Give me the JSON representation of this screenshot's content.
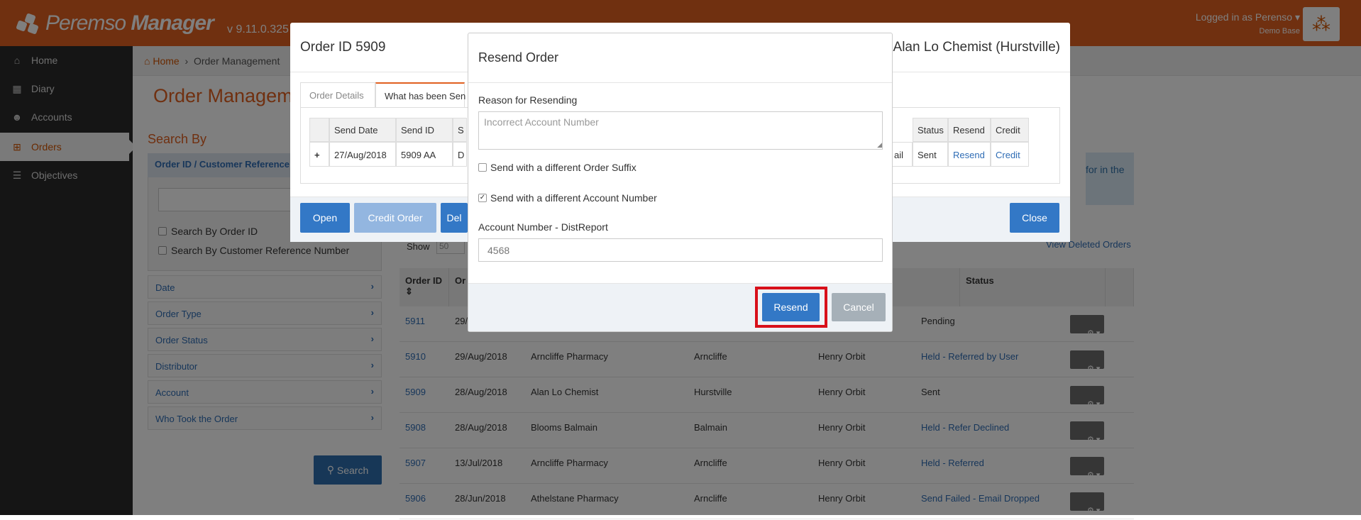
{
  "header": {
    "app_name_light": "Peremso",
    "app_name_bold": "Manager",
    "version": "v 9.11.0.325",
    "logged_in": "Logged in as Perenso",
    "base": "Demo Base"
  },
  "sidebar": {
    "items": [
      {
        "label": "Home",
        "icon": "home-icon"
      },
      {
        "label": "Diary",
        "icon": "calendar-icon"
      },
      {
        "label": "Accounts",
        "icon": "users-icon"
      },
      {
        "label": "Orders",
        "icon": "cart-icon"
      },
      {
        "label": "Objectives",
        "icon": "list-icon"
      }
    ],
    "active": "Orders"
  },
  "breadcrumb": {
    "home": "Home",
    "current": "Order Management"
  },
  "page": {
    "title": "Order Manageme",
    "search_by": "Search By",
    "search_panel_title": "Order ID / Customer Reference",
    "chk_order_id": "Search By Order ID",
    "chk_cust_ref": "Search By Customer Reference Number",
    "filters": [
      "Date",
      "Order Type",
      "Order Status",
      "Distributor",
      "Account",
      "Who Took the Order"
    ],
    "search_button": "Search",
    "info_text": "for in the",
    "view_deleted": "View Deleted Orders",
    "show_label": "Show",
    "show_value": "50"
  },
  "orders_table": {
    "headers": [
      "Order ID",
      "Or",
      "Status"
    ],
    "rows": [
      {
        "id": "5911",
        "date": "29/",
        "name": "",
        "suburb": "",
        "rep": "",
        "status": "Pending",
        "status_link": false
      },
      {
        "id": "5910",
        "date": "29/Aug/2018",
        "name": "Arncliffe Pharmacy",
        "suburb": "Arncliffe",
        "rep": "Henry Orbit",
        "status": "Held - Referred by User",
        "status_link": true
      },
      {
        "id": "5909",
        "date": "28/Aug/2018",
        "name": "Alan Lo Chemist",
        "suburb": "Hurstville",
        "rep": "Henry Orbit",
        "status": "Sent",
        "status_link": false
      },
      {
        "id": "5908",
        "date": "28/Aug/2018",
        "name": "Blooms Balmain",
        "suburb": "Balmain",
        "rep": "Henry Orbit",
        "status": "Held - Refer Declined",
        "status_link": true
      },
      {
        "id": "5907",
        "date": "13/Jul/2018",
        "name": "Arncliffe Pharmacy",
        "suburb": "Arncliffe",
        "rep": "Henry Orbit",
        "status": "Held - Referred",
        "status_link": true
      },
      {
        "id": "5906",
        "date": "28/Jun/2018",
        "name": "Athelstane Pharmacy",
        "suburb": "Arncliffe",
        "rep": "Henry Orbit",
        "status": "Send Failed - Email Dropped",
        "status_link": true
      }
    ]
  },
  "order_modal": {
    "title": "Order ID 5909",
    "customer": "Alan Lo Chemist (Hurstville)",
    "tabs": [
      "Order Details",
      "What has been Sen"
    ],
    "table_headers": [
      "Send Date",
      "Send ID",
      "S",
      "Status",
      "Resend",
      "Credit"
    ],
    "row": {
      "expand": "+",
      "send_date": "27/Aug/2018",
      "send_id": "5909  AA",
      "s": "D",
      "mid": "ail",
      "status": "Sent",
      "resend": "Resend",
      "credit": "Credit"
    },
    "buttons": {
      "open": "Open",
      "credit": "Credit Order",
      "del": "Del",
      "close": "Close"
    }
  },
  "resend_modal": {
    "title": "Resend Order",
    "reason_label": "Reason for Resending",
    "reason_placeholder": "Incorrect Account Number",
    "chk_suffix": "Send with a different Order Suffix",
    "chk_suffix_checked": false,
    "chk_account": "Send with a different Account Number",
    "chk_account_checked": true,
    "account_label": "Account Number - DistReport",
    "account_value": "4568",
    "resend_button": "Resend",
    "cancel_button": "Cancel"
  },
  "colors": {
    "brand": "#e06020",
    "link": "#2f6db5",
    "primary_button": "#3378c6",
    "highlight": "#d8101a"
  }
}
